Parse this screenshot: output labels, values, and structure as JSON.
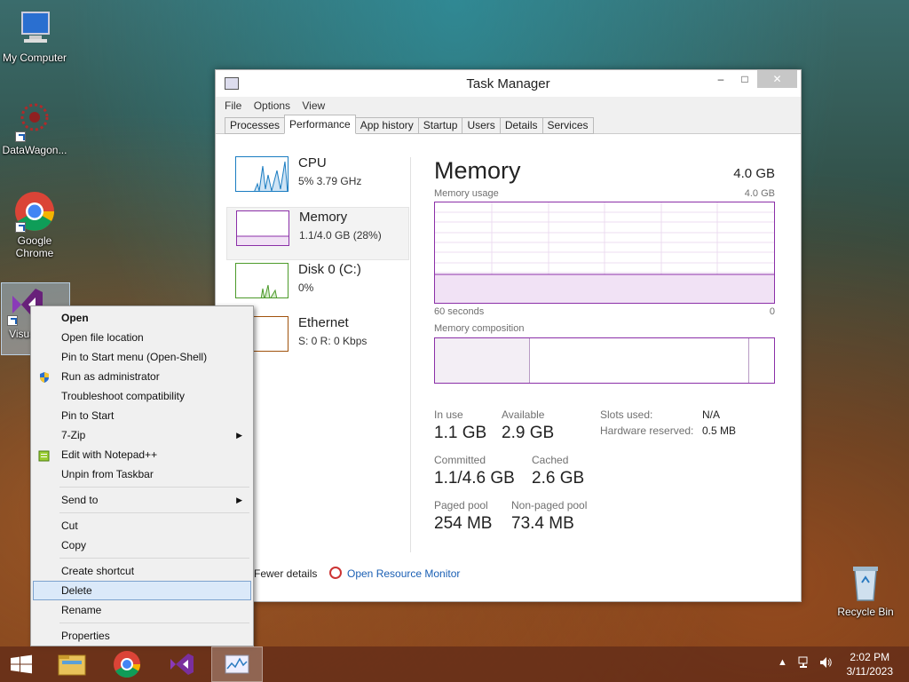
{
  "desktop": {
    "icons": [
      {
        "label": "My Computer"
      },
      {
        "label": "DataWagon..."
      },
      {
        "label": "Google Chrome"
      },
      {
        "label": "Visua... 2..."
      },
      {
        "label": "Recycle Bin"
      }
    ]
  },
  "task_manager": {
    "title": "Task Manager",
    "window_buttons": {
      "minimize": "–",
      "maximize": "□",
      "close": "✕"
    },
    "menu": [
      "File",
      "Options",
      "View"
    ],
    "tabs": [
      "Processes",
      "Performance",
      "App history",
      "Startup",
      "Users",
      "Details",
      "Services"
    ],
    "active_tab": "Performance",
    "sidebar": [
      {
        "name": "CPU",
        "sub": "5%  3.79 GHz",
        "color": "#1a7cc1"
      },
      {
        "name": "Memory",
        "sub": "1.1/4.0 GB (28%)",
        "color": "#8b2fa8"
      },
      {
        "name": "Disk 0 (C:)",
        "sub": "0%",
        "color": "#4c9a2a"
      },
      {
        "name": "Ethernet",
        "sub": "S: 0  R: 0 Kbps",
        "color": "#a0520d"
      }
    ],
    "main": {
      "title": "Memory",
      "total": "4.0 GB",
      "usage_label": "Memory usage",
      "usage_max": "4.0 GB",
      "axis_left": "60 seconds",
      "axis_right": "0",
      "composition_label": "Memory composition",
      "usage_fraction": 0.28,
      "stats": {
        "in_use_label": "In use",
        "in_use": "1.1 GB",
        "available_label": "Available",
        "available": "2.9 GB",
        "committed_label": "Committed",
        "committed": "1.1/4.6 GB",
        "cached_label": "Cached",
        "cached": "2.6 GB",
        "paged_label": "Paged pool",
        "paged": "254 MB",
        "nonpaged_label": "Non-paged pool",
        "nonpaged": "73.4 MB",
        "slots_label": "Slots used:",
        "slots": "N/A",
        "hw_label": "Hardware reserved:",
        "hw": "0.5 MB"
      }
    },
    "footer": {
      "fewer": "Fewer details",
      "resource_monitor": "Open Resource Monitor"
    }
  },
  "context_menu": {
    "items": [
      {
        "label": "Open",
        "bold": true
      },
      {
        "label": "Open file location"
      },
      {
        "label": "Pin to Start menu (Open-Shell)"
      },
      {
        "label": "Run as administrator",
        "icon": "shield-icon"
      },
      {
        "label": "Troubleshoot compatibility"
      },
      {
        "label": "Pin to Start"
      },
      {
        "label": "7-Zip",
        "submenu": true
      },
      {
        "label": "Edit with Notepad++",
        "icon": "notepad-icon"
      },
      {
        "label": "Unpin from Taskbar"
      },
      {
        "sep": true
      },
      {
        "label": "Send to",
        "submenu": true
      },
      {
        "sep": true
      },
      {
        "label": "Cut"
      },
      {
        "label": "Copy"
      },
      {
        "sep": true
      },
      {
        "label": "Create shortcut"
      },
      {
        "label": "Delete",
        "hover": true
      },
      {
        "label": "Rename"
      },
      {
        "sep": true
      },
      {
        "label": "Properties"
      }
    ]
  },
  "taskbar": {
    "time": "2:02 PM",
    "date": "3/11/2023"
  }
}
